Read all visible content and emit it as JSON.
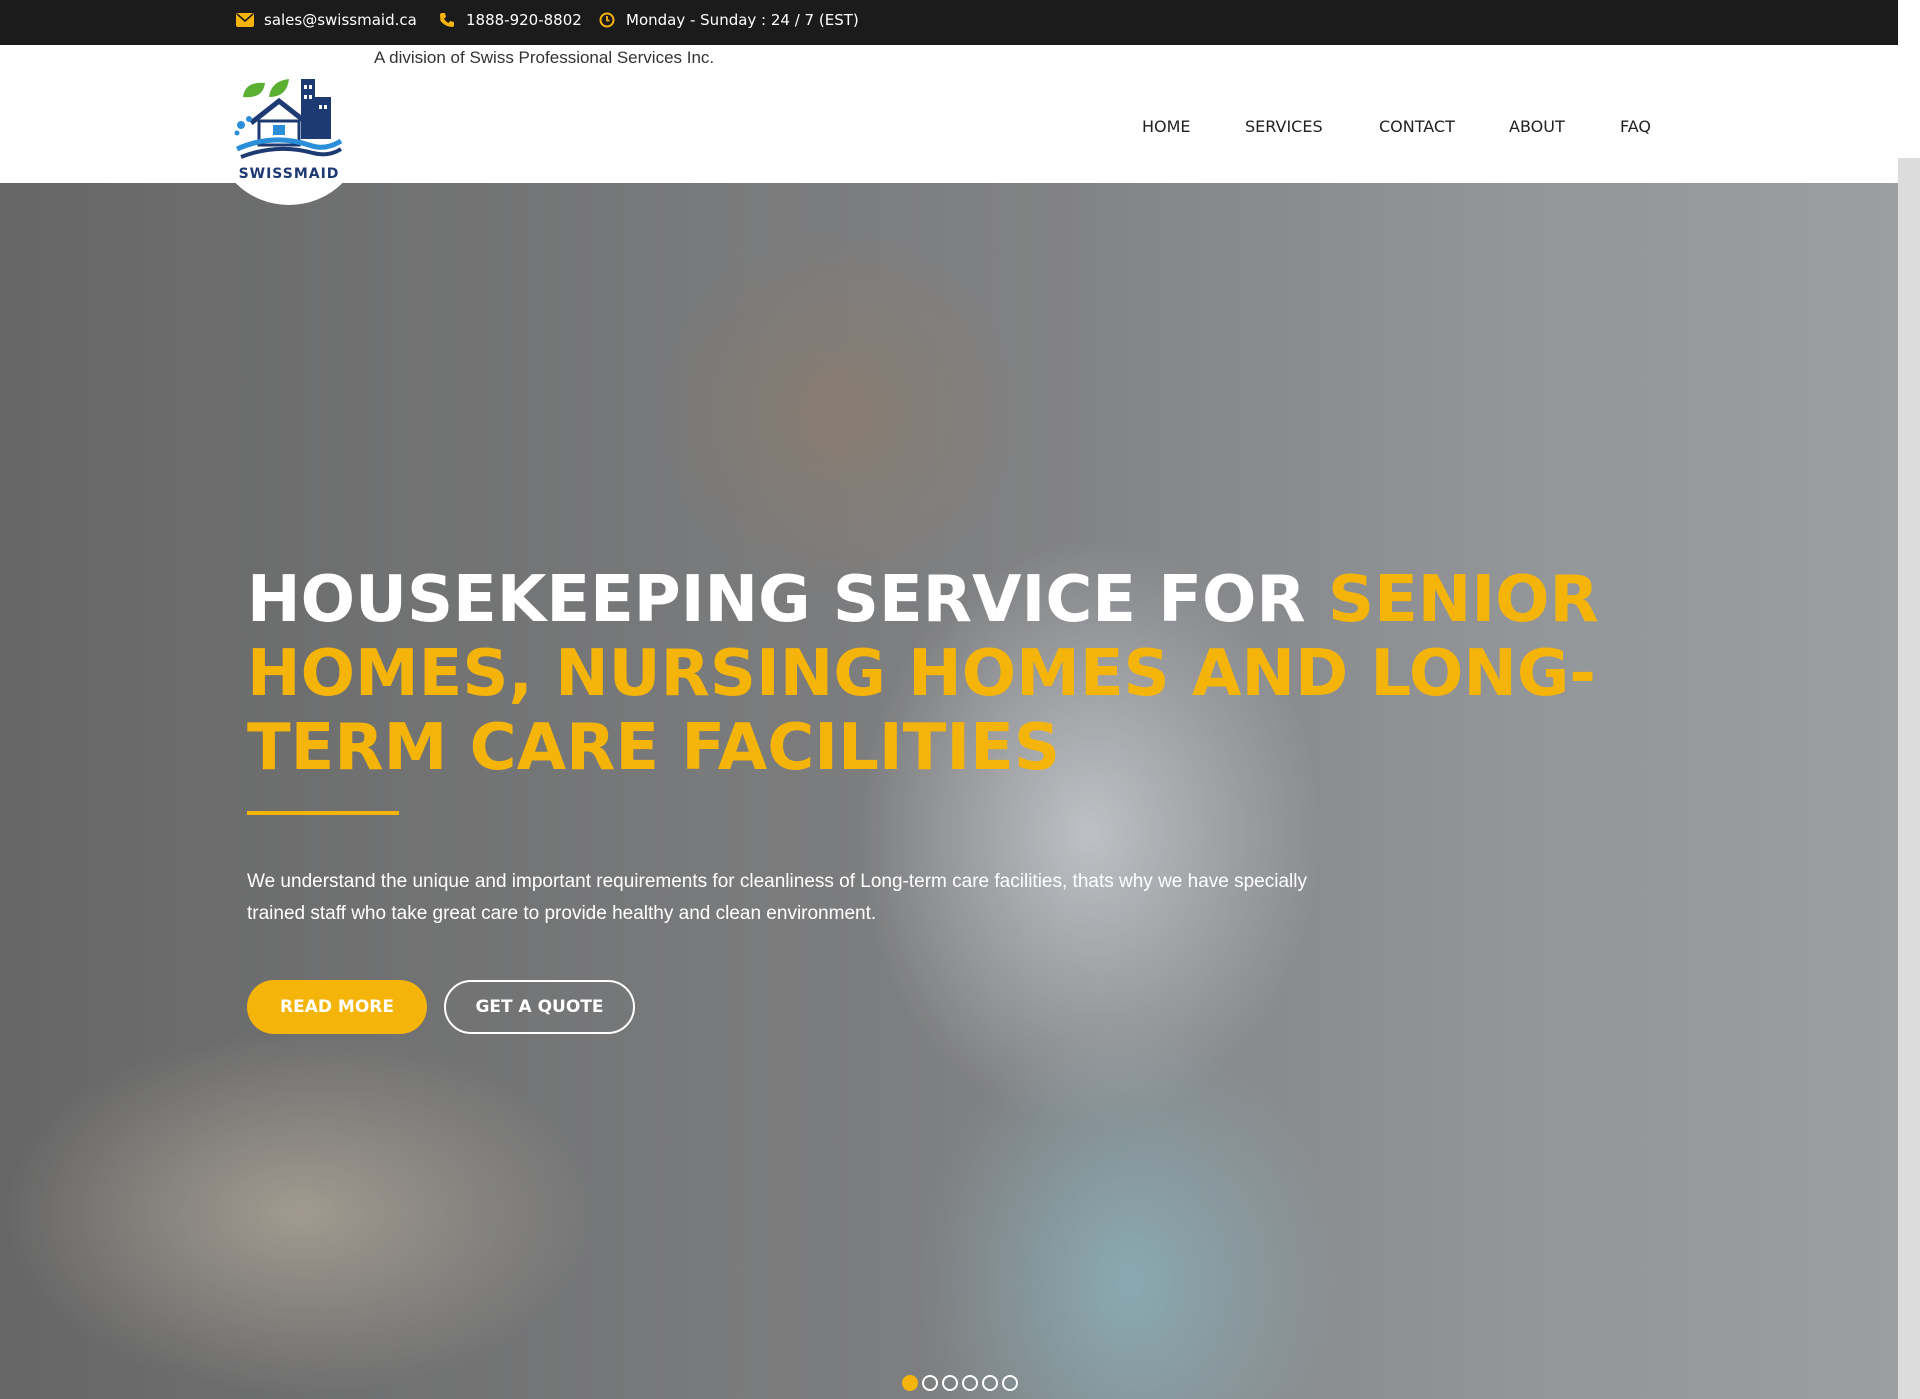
{
  "topbar": {
    "email": "sales@swissmaid.ca",
    "phone": "1888-920-8802",
    "hours": "Monday - Sunday : 24 / 7 (EST)",
    "email_icon": "envelope-icon",
    "phone_icon": "phone-icon",
    "hours_icon": "clock-icon"
  },
  "header": {
    "division": "A division of Swiss Professional Services Inc.",
    "logo_text": "SWISSMAID"
  },
  "nav": {
    "items": [
      {
        "label": "HOME"
      },
      {
        "label": "SERVICES"
      },
      {
        "label": "CONTACT"
      },
      {
        "label": "ABOUT"
      },
      {
        "label": "FAQ"
      }
    ]
  },
  "hero": {
    "title_white": "HOUSEKEEPING SERVICE FOR ",
    "title_highlight": "SENIOR HOMES, NURSING HOMES AND LONG-TERM CARE FACILITIES",
    "description": "We understand the unique and important requirements for cleanliness of Long-term care facilities, thats why we have specially trained staff who take great care to provide healthy and clean environment.",
    "read_more": "READ MORE",
    "get_quote": "GET A QUOTE",
    "slides_total": 6,
    "slide_active": 1
  },
  "colors": {
    "accent": "#f5b40a",
    "topbar": "#1b1b1b",
    "logo_navy": "#1e3a72",
    "logo_green": "#5cb031",
    "logo_blue": "#2a8fd8"
  }
}
